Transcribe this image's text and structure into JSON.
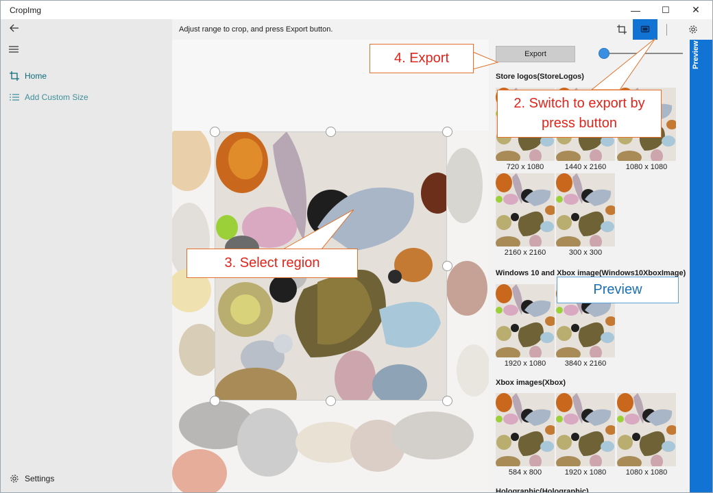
{
  "window": {
    "title": "CropImg",
    "minimize_glyph": "—",
    "maximize_glyph": "☐",
    "close_glyph": "✕"
  },
  "nav": {
    "back_icon": "back-arrow-icon",
    "menu_icon": "hamburger-icon",
    "items": [
      {
        "label": "Home",
        "icon": "crop-icon",
        "selected": true
      },
      {
        "label": "Add Custom Size",
        "icon": "list-icon",
        "selected": false
      }
    ],
    "settings_label": "Settings",
    "settings_icon": "gear-icon"
  },
  "commandbar": {
    "instruction": "Adjust range to crop, and press Export button.",
    "crop_icon": "crop-icon",
    "preview_toggle_icon": "monitor-icon",
    "settings_icon": "gear-icon",
    "accent": "#1173d4"
  },
  "preview": {
    "export_label": "Export",
    "slider_value": 0.0,
    "tab_label": "Preview",
    "groups": [
      {
        "title": "Store logos(StoreLogos)",
        "items": [
          "720 x 1080",
          "1440 x 2160",
          "1080 x 1080",
          "2160 x 2160",
          "300 x 300"
        ]
      },
      {
        "title": "Windows 10 and Xbox image(Windows10XboxImage)",
        "items": [
          "1920 x 1080",
          "3840 x 2160"
        ]
      },
      {
        "title": "Xbox images(Xbox)",
        "items": [
          "584 x 800",
          "1920 x 1080",
          "1080 x 1080"
        ]
      },
      {
        "title": "Holographic(Holographic)",
        "items": []
      }
    ]
  },
  "callouts": {
    "switch": "2. Switch to export by press button",
    "select": "3. Select region",
    "export": "4. Export",
    "preview": "Preview",
    "accent": "#e0241b",
    "border": "#e2702a"
  }
}
